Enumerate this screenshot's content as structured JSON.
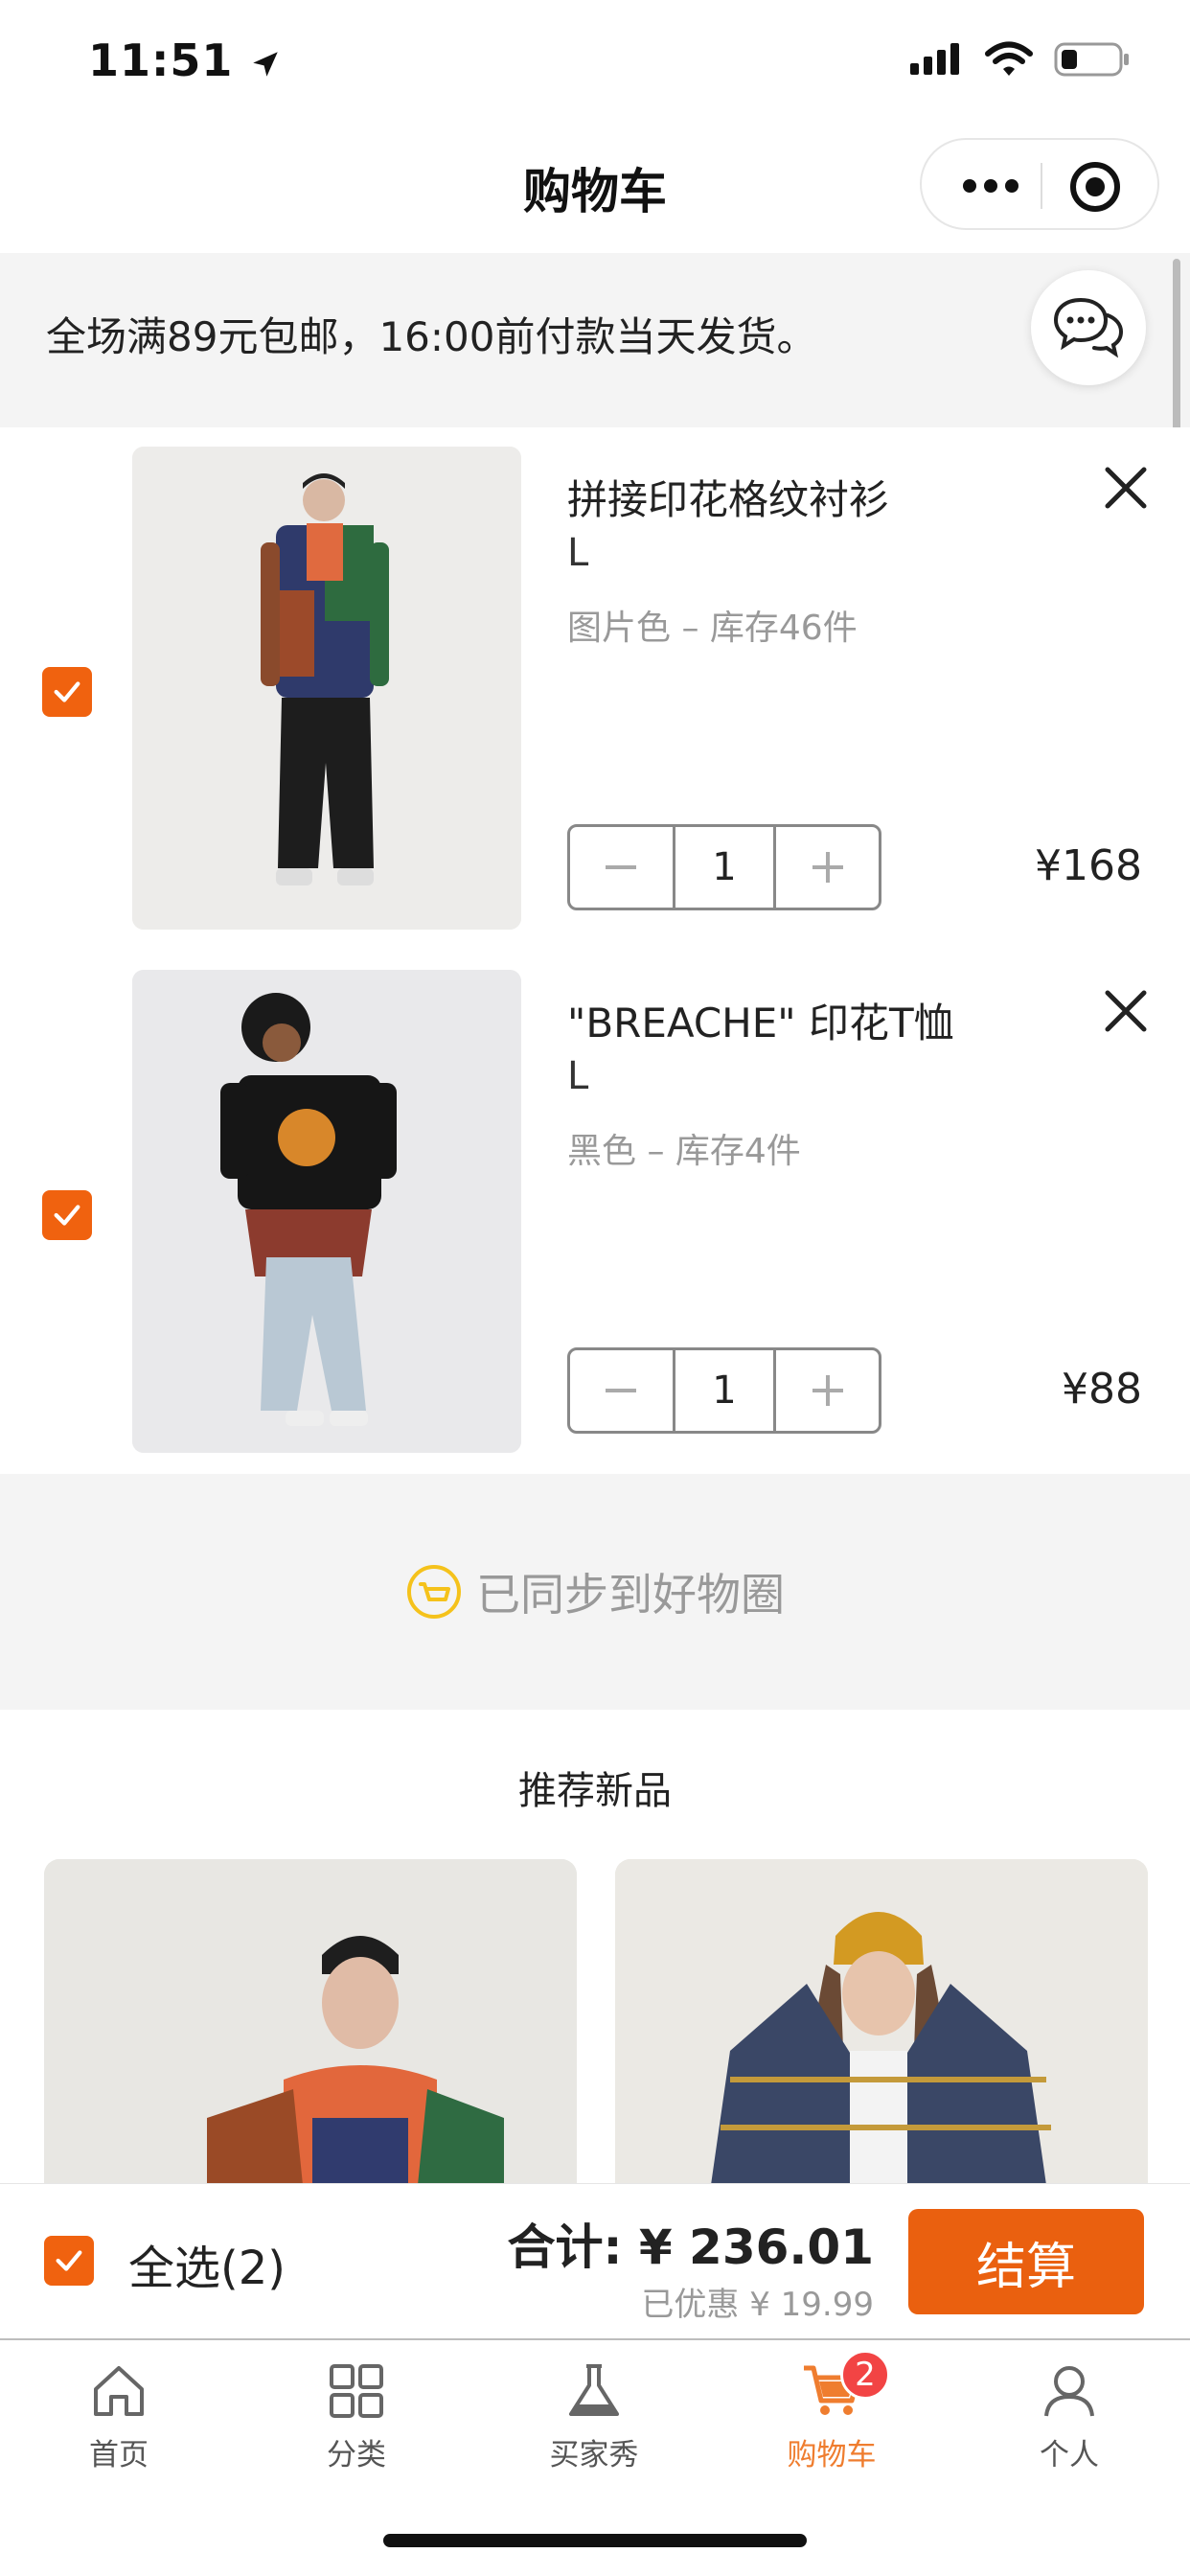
{
  "status_bar": {
    "time": "11:51"
  },
  "nav": {
    "title": "购物车"
  },
  "notice": {
    "text": "全场满89元包邮，16:00前付款当天发货。"
  },
  "cart": {
    "items": [
      {
        "name": "拼接印花格纹衬衫",
        "size": "L",
        "spec": "图片色 – 库存46件",
        "quantity": "1",
        "price": "¥168",
        "checked": true,
        "image": "man-in-plaid-patchwork-shirt"
      },
      {
        "name": "\"BREACHE\" 印花T恤",
        "size": "L",
        "spec": "黑色 – 库存4件",
        "quantity": "1",
        "price": "¥88",
        "checked": true,
        "image": "man-in-black-tiger-print-tee"
      }
    ]
  },
  "sync": {
    "text": "已同步到好物圈"
  },
  "recommend": {
    "title": "推荐新品",
    "cards": [
      {
        "image": "man-in-beanie-plaid-shirt"
      },
      {
        "image": "woman-in-yellow-beanie-plaid-shirt"
      }
    ]
  },
  "checkout": {
    "select_all_label": "全选(2)",
    "total": "合计: ¥ 236.01",
    "discount": "已优惠 ¥ 19.99",
    "pay_label": "结算"
  },
  "tabbar": {
    "tabs": [
      {
        "label": "首页",
        "icon": "home-icon"
      },
      {
        "label": "分类",
        "icon": "grid-icon"
      },
      {
        "label": "买家秀",
        "icon": "flask-icon"
      },
      {
        "label": "购物车",
        "icon": "cart-icon",
        "active": true,
        "badge": "2"
      },
      {
        "label": "个人",
        "icon": "user-icon"
      }
    ]
  },
  "colors": {
    "accent": "#ea600f",
    "badge": "#f24444",
    "active_tab": "#ef7d2f"
  }
}
